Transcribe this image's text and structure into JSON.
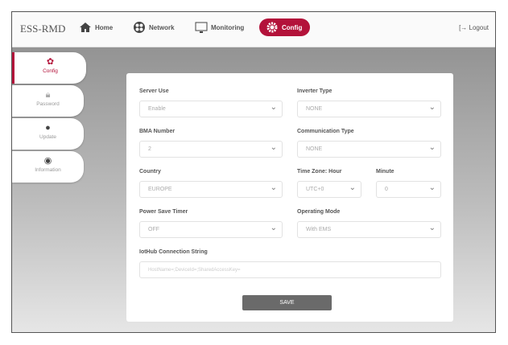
{
  "header": {
    "brand": "ESS-RMD",
    "nav": [
      {
        "label": "Home",
        "icon": "home-icon"
      },
      {
        "label": "Network",
        "icon": "globe-icon"
      },
      {
        "label": "Monitoring",
        "icon": "monitor-icon"
      },
      {
        "label": "Config",
        "icon": "gear-icon"
      }
    ],
    "active": "Config",
    "logout": "Logout"
  },
  "sidebar": [
    {
      "label": "Config",
      "icon": "gear-icon"
    },
    {
      "label": "Password",
      "icon": "lock-icon"
    },
    {
      "label": "Update",
      "icon": "update-icon"
    },
    {
      "label": "Information",
      "icon": "info-icon"
    }
  ],
  "form": {
    "server_use": {
      "label": "Server Use",
      "value": "Enable"
    },
    "inverter_type": {
      "label": "Inverter Type",
      "value": "NONE"
    },
    "bma_number": {
      "label": "BMA Number",
      "value": "2"
    },
    "communication_type": {
      "label": "Communication Type",
      "value": "NONE"
    },
    "country": {
      "label": "Country",
      "value": "EUROPE"
    },
    "tz_hour": {
      "label": "Time Zone: Hour",
      "value": "UTC+0"
    },
    "tz_minute": {
      "label": "Minute",
      "value": "0"
    },
    "power_save": {
      "label": "Power Save Timer",
      "value": "OFF"
    },
    "operating_mode": {
      "label": "Operating Mode",
      "value": "With EMS"
    },
    "iothub": {
      "label": "IotHub Connection String",
      "placeholder": "HostName=;DeviceId=;SharedAccessKey="
    },
    "save": "SAVE"
  },
  "colors": {
    "accent": "#b3123a"
  }
}
